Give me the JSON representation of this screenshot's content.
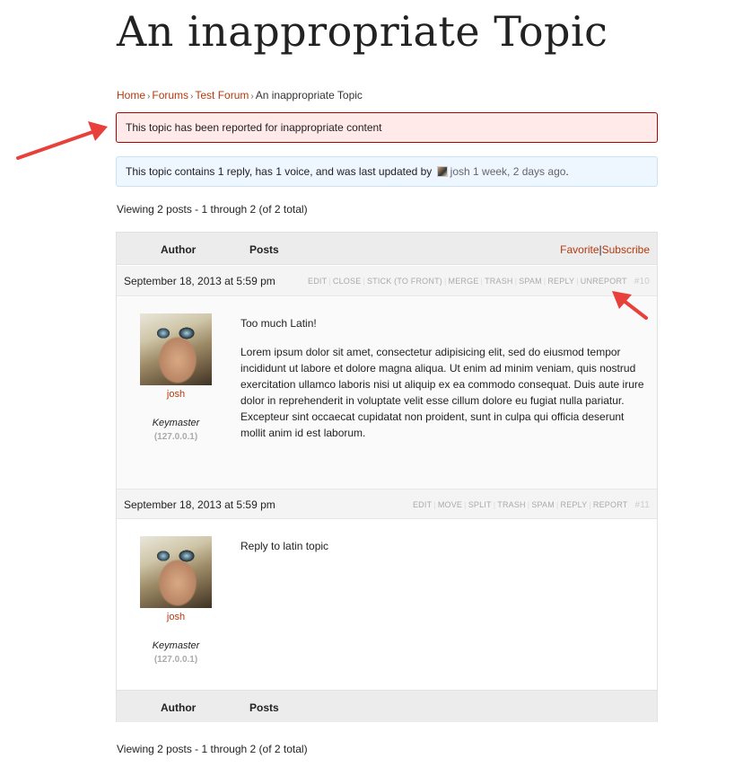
{
  "page": {
    "title": "An inappropriate Topic"
  },
  "breadcrumb": {
    "items": [
      "Home",
      "Forums",
      "Test Forum"
    ],
    "current": "An inappropriate Topic",
    "separator": "›"
  },
  "notices": {
    "reported": "This topic has been reported for inappropriate content",
    "info_prefix": "This topic contains 1 reply, has 1 voice, and was last updated by",
    "info_author": "josh",
    "info_time": "1 week, 2 days ago",
    "info_suffix": "."
  },
  "pagination": {
    "text": "Viewing 2 posts - 1 through 2 (of 2 total)"
  },
  "table_header": {
    "author": "Author",
    "posts": "Posts",
    "favorite": "Favorite",
    "divider": "|",
    "subscribe": "Subscribe"
  },
  "replies": [
    {
      "date": "September 18, 2013 at 5:59 pm",
      "admin_links": [
        "Edit",
        "Close",
        "Stick (to front)",
        "Merge",
        "Trash",
        "Spam",
        "Reply",
        "Unreport"
      ],
      "number": "#10",
      "author": "josh",
      "role": "Keymaster",
      "ip": "(127.0.0.1)",
      "paragraphs": [
        "Too much Latin!",
        "Lorem ipsum dolor sit amet, consectetur adipisicing elit, sed do eiusmod tempor incididunt ut labore et dolore magna aliqua. Ut enim ad minim veniam, quis nostrud exercitation ullamco laboris nisi ut aliquip ex ea commodo consequat. Duis aute irure dolor in reprehenderit in voluptate velit esse cillum dolore eu fugiat nulla pariatur. Excepteur sint occaecat cupidatat non proident, sunt in culpa qui officia deserunt mollit anim id est laborum."
      ]
    },
    {
      "date": "September 18, 2013 at 5:59 pm",
      "admin_links": [
        "Edit",
        "Move",
        "Split",
        "Trash",
        "Spam",
        "Reply",
        "Report"
      ],
      "number": "#11",
      "author": "josh",
      "role": "Keymaster",
      "ip": "(127.0.0.1)",
      "paragraphs": [
        "Reply to latin topic"
      ]
    }
  ],
  "colors": {
    "link": "#b23a0f",
    "error_bg": "#ffe9e9",
    "error_border": "#b30000",
    "info_bg": "#eef6ff",
    "arrow": "#e8403a"
  }
}
